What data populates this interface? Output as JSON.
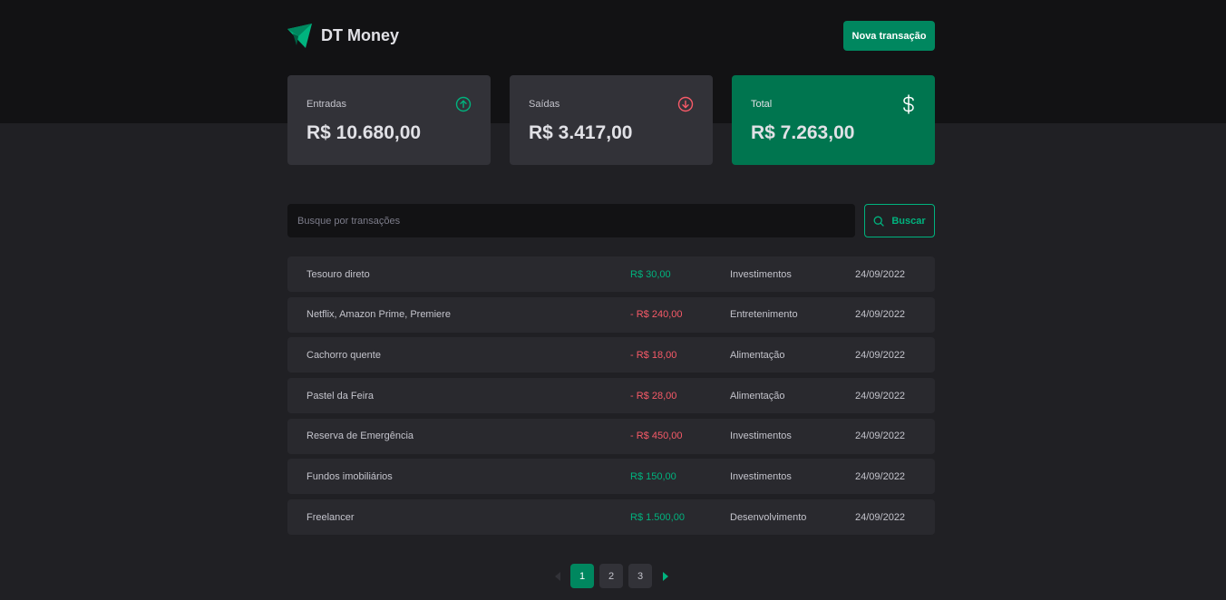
{
  "app": {
    "name": "DT Money",
    "new_transaction_label": "Nova transação"
  },
  "colors": {
    "brand": "#00875F",
    "income": "#00B37E",
    "outcome": "#F75A68",
    "background": "#202024",
    "header": "#121214"
  },
  "summary": {
    "income": {
      "label": "Entradas",
      "value": "R$ 10.680,00",
      "icon": "arrow-circle-up-icon"
    },
    "outcome": {
      "label": "Saídas",
      "value": "R$ 3.417,00",
      "icon": "arrow-circle-down-icon"
    },
    "total": {
      "label": "Total",
      "value": "R$ 7.263,00",
      "icon": "currency-dollar-icon"
    }
  },
  "search": {
    "placeholder": "Busque por transações",
    "button_label": "Buscar",
    "icon": "search-icon"
  },
  "transactions": [
    {
      "description": "Tesouro direto",
      "price": "R$ 30,00",
      "type": "income",
      "category": "Investimentos",
      "date": "24/09/2022"
    },
    {
      "description": "Netflix, Amazon Prime, Premiere",
      "price": "- R$ 240,00",
      "type": "outcome",
      "category": "Entretenimento",
      "date": "24/09/2022"
    },
    {
      "description": "Cachorro quente",
      "price": "- R$ 18,00",
      "type": "outcome",
      "category": "Alimentação",
      "date": "24/09/2022"
    },
    {
      "description": "Pastel da Feira",
      "price": "- R$ 28,00",
      "type": "outcome",
      "category": "Alimentação",
      "date": "24/09/2022"
    },
    {
      "description": "Reserva de Emergência",
      "price": "- R$ 450,00",
      "type": "outcome",
      "category": "Investimentos",
      "date": "24/09/2022"
    },
    {
      "description": "Fundos imobiliários",
      "price": "R$ 150,00",
      "type": "income",
      "category": "Investimentos",
      "date": "24/09/2022"
    },
    {
      "description": "Freelancer",
      "price": "R$ 1.500,00",
      "type": "income",
      "category": "Desenvolvimento",
      "date": "24/09/2022"
    }
  ],
  "pagination": {
    "pages": [
      "1",
      "2",
      "3"
    ],
    "current": "1",
    "prev_icon": "caret-left-icon",
    "next_icon": "caret-right-icon"
  }
}
